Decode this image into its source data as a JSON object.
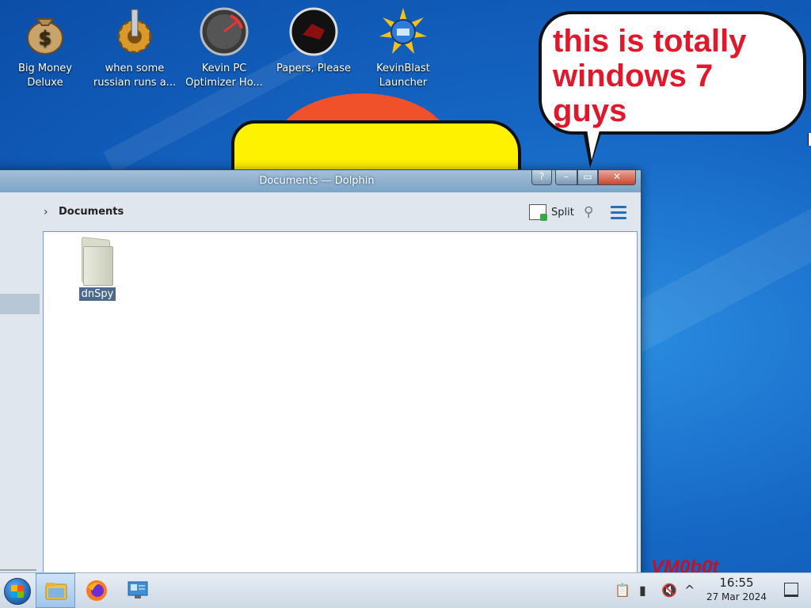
{
  "desktop": {
    "icons": [
      {
        "label_line1": "Big Money",
        "label_line2": "Deluxe",
        "icon": "money-bag-icon"
      },
      {
        "label_line1": "when some",
        "label_line2": "russian runs a...",
        "icon": "gear-syringe-icon"
      },
      {
        "label_line1": "Kevin PC",
        "label_line2": "Optimizer Ho...",
        "icon": "speedometer-icon"
      },
      {
        "label_line1": "Papers, Please",
        "label_line2": "",
        "icon": "papers-please-icon"
      },
      {
        "label_line1": "KevinBlast",
        "label_line2": "Launcher",
        "icon": "disc-burst-icon"
      }
    ],
    "speech_bubble_text": "this is totally windows 7 guys",
    "watermark": "VM0b0t"
  },
  "window": {
    "title": "Documents — Dolphin",
    "buttons": {
      "help": "?",
      "minimize": "–",
      "maximize": "▭",
      "close": "✕"
    },
    "breadcrumb": "Documents",
    "split_label": "Split",
    "files": [
      {
        "name": "dnSpy",
        "icon": "folder-icon"
      }
    ]
  },
  "taskbar": {
    "apps": [
      {
        "icon": "file-manager-icon",
        "active": true
      },
      {
        "icon": "firefox-icon",
        "active": false
      },
      {
        "icon": "system-settings-icon",
        "active": false
      }
    ],
    "tray_icons": [
      "clipboard-icon",
      "battery-icon",
      "volume-muted-icon",
      "chevron-up-icon"
    ],
    "time": "16:55",
    "date": "27 Mar 2024"
  },
  "colors": {
    "bubble_text": "#e0182c",
    "watermark": "#c0132a",
    "accent": "#2a6fb5"
  }
}
